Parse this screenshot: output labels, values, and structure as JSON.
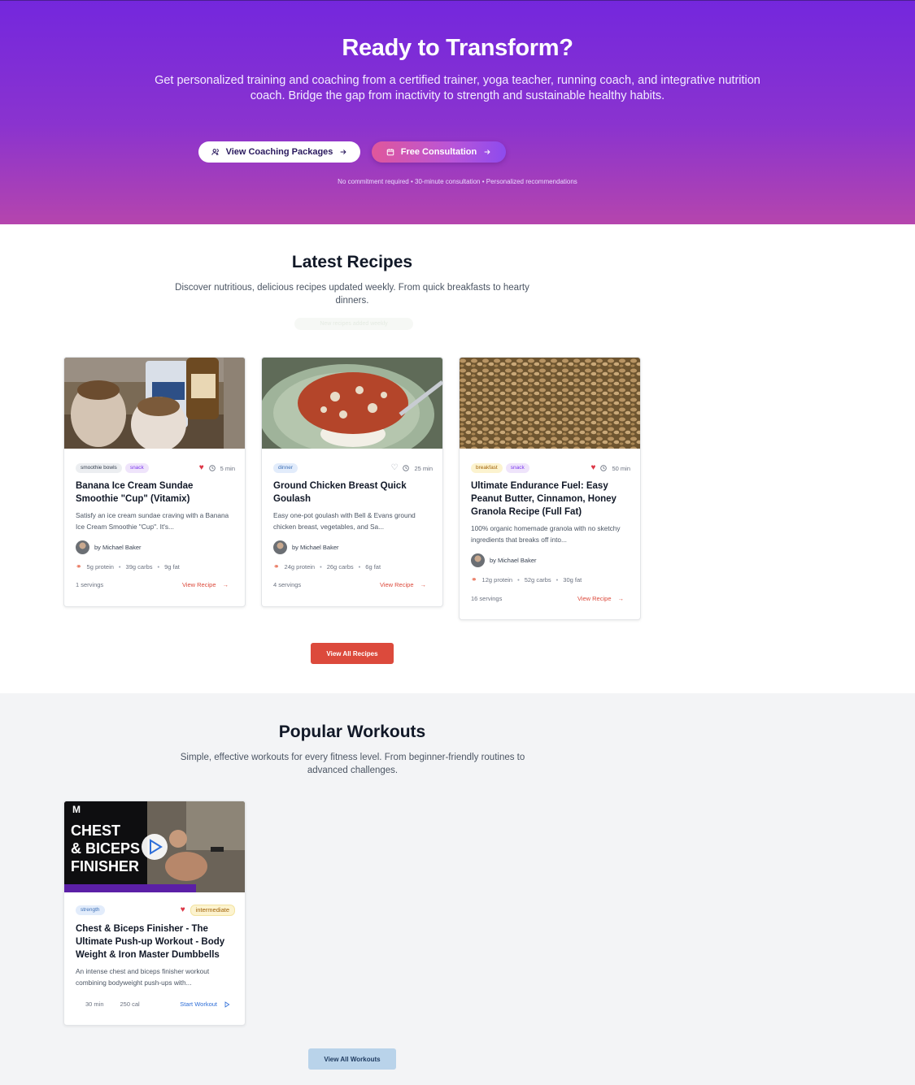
{
  "hero": {
    "title": "Ready to Transform?",
    "lead": "Get personalized training and coaching from a certified trainer, yoga teacher, running coach, and integrative nutrition coach. Bridge the gap from inactivity to strength and sustainable healthy habits.",
    "btn_packages": "View Coaching Packages",
    "btn_consult": "Free Consultation",
    "fine_print": "No commitment required • 30-minute consultation • Personalized recommendations"
  },
  "recipes": {
    "title": "Latest Recipes",
    "subtitle": "Discover nutritious, delicious recipes updated weekly. From quick breakfasts to hearty dinners.",
    "ghost_pill": "New recipes added weekly",
    "view_all": "View All Recipes",
    "items": [
      {
        "tags": [
          "smoothie bowls",
          "snack"
        ],
        "favorited": true,
        "time": "5 min",
        "title": "Banana Ice Cream Sundae Smoothie \"Cup\" (Vitamix)",
        "description": "Satisfy an ice cream sundae craving with a Banana Ice Cream Smoothie \"Cup\". It's...",
        "author": "by Michael Baker",
        "protein": "5g protein",
        "carbs": "39g carbs",
        "fat": "9g fat",
        "servings": "1 servings",
        "link": "View Recipe"
      },
      {
        "tags": [
          "dinner"
        ],
        "favorited": false,
        "time": "25 min",
        "title": "Ground Chicken Breast Quick Goulash",
        "description": "Easy one-pot goulash with Bell & Evans ground chicken breast, vegetables, and Sa...",
        "author": "by Michael Baker",
        "protein": "24g protein",
        "carbs": "26g carbs",
        "fat": "6g fat",
        "servings": "4 servings",
        "link": "View Recipe"
      },
      {
        "tags": [
          "breakfast",
          "snack"
        ],
        "favorited": true,
        "time": "50 min",
        "title": "Ultimate Endurance Fuel: Easy Peanut Butter, Cinnamon, Honey Granola Recipe (Full Fat)",
        "description": "100% organic homemade granola with no sketchy ingredients that breaks off into...",
        "author": "by Michael Baker",
        "protein": "12g protein",
        "carbs": "52g carbs",
        "fat": "30g fat",
        "servings": "16 servings",
        "link": "View Recipe"
      }
    ]
  },
  "workouts": {
    "title": "Popular Workouts",
    "subtitle": "Simple, effective workouts for every fitness level. From beginner-friendly routines to advanced challenges.",
    "view_all": "View All Workouts",
    "items": [
      {
        "thumb_text": [
          "CHEST",
          "& BICEPS",
          "FINISHER"
        ],
        "thumb_logo": "M",
        "tags": [
          "strength",
          "intermediate"
        ],
        "favorited": true,
        "title": "Chest & Biceps Finisher - The Ultimate Push-up Workout - Body Weight & Iron Master Dumbbells",
        "description": "An intense chest and biceps finisher workout combining bodyweight push-ups with...",
        "duration": "30 min",
        "calories": "250 cal",
        "link": "Start Workout"
      }
    ]
  },
  "colors": {
    "hero_purple": "#7427dd",
    "hero_pink": "#b545ad",
    "recipe_red": "#dc4a3c",
    "workout_blue": "#b9d3ea",
    "heart": "#dc3545"
  },
  "icons": [
    "users-icon",
    "arrow-right-icon",
    "calendar-icon",
    "heart-icon",
    "clock-icon",
    "macro-icon",
    "play-icon",
    "flame-icon"
  ]
}
